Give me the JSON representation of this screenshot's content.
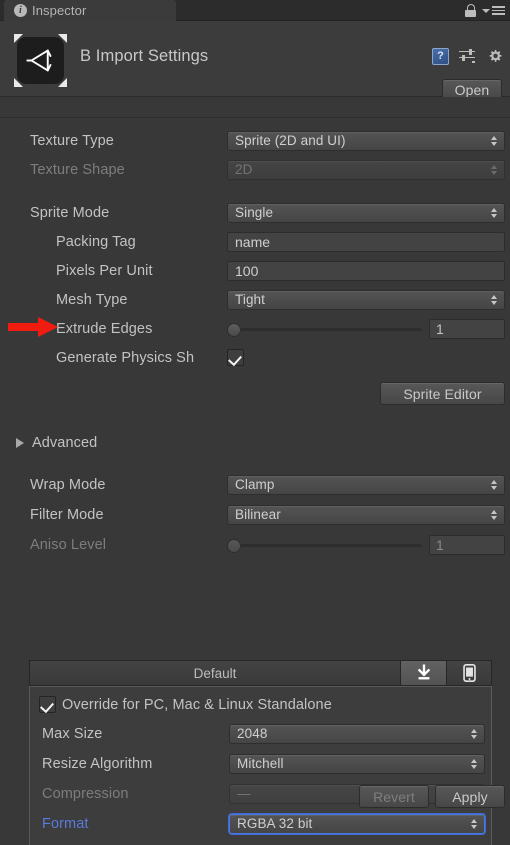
{
  "window": {
    "background_color": "#383838",
    "panel_color": "#3c3c3c"
  },
  "tabbar": {
    "tab_label": "Inspector",
    "info_icon": "info-icon",
    "lock_icon": "lock-icon",
    "menu_icon": "hamburger-menu-icon"
  },
  "header": {
    "object_icon": "unity-asset-icon",
    "title": "B Import Settings",
    "help_icon": "help-book-icon",
    "help_glyph": "?",
    "preset_icon": "preset-sliders-icon",
    "gear_icon": "gear-icon",
    "open_button": "Open"
  },
  "fields": {
    "texture_type": {
      "label": "Texture Type",
      "value": "Sprite (2D and UI)",
      "disabled": false
    },
    "texture_shape": {
      "label": "Texture Shape",
      "value": "2D",
      "disabled": true
    },
    "sprite_mode": {
      "label": "Sprite Mode",
      "value": "Single",
      "disabled": false
    },
    "packing_tag": {
      "label": "Packing Tag",
      "value": "name"
    },
    "pixels_per_unit": {
      "label": "Pixels Per Unit",
      "value": "100"
    },
    "mesh_type": {
      "label": "Mesh Type",
      "value": "Tight",
      "disabled": false
    },
    "extrude_edges": {
      "label": "Extrude Edges",
      "value": "1",
      "slider_percent": 0
    },
    "generate_physics_shape": {
      "label": "Generate Physics Sh",
      "checked": true
    },
    "sprite_editor_button": "Sprite Editor",
    "advanced_foldout": {
      "label": "Advanced",
      "expanded": false
    },
    "wrap_mode": {
      "label": "Wrap Mode",
      "value": "Clamp",
      "disabled": false
    },
    "filter_mode": {
      "label": "Filter Mode",
      "value": "Bilinear",
      "disabled": false
    },
    "aniso_level": {
      "label": "Aniso Level",
      "value": "1",
      "slider_percent": 0,
      "disabled": true
    }
  },
  "platform": {
    "tabs": [
      {
        "label": "Default",
        "icon": "text-tab",
        "selected": false
      },
      {
        "label": "",
        "icon": "standalone-download-icon",
        "selected": true
      },
      {
        "label": "",
        "icon": "mobile-phone-icon",
        "selected": false
      }
    ],
    "override_checkbox": {
      "label": "Override for PC, Mac & Linux Standalone",
      "checked": true
    },
    "max_size": {
      "label": "Max Size",
      "value": "2048",
      "disabled": false
    },
    "resize_algorithm": {
      "label": "Resize Algorithm",
      "value": "Mitchell",
      "disabled": false
    },
    "compression": {
      "label": "Compression",
      "value": "—",
      "disabled": true
    },
    "format": {
      "label": "Format",
      "value": "RGBA 32 bit",
      "disabled": false,
      "highlighted": true,
      "label_color": "#5a7bdc"
    }
  },
  "footer": {
    "revert_button": "Revert",
    "apply_button": "Apply"
  },
  "annotation": {
    "arrow_icon": "red-arrow-annotation",
    "arrow_color": "#f01c10",
    "points_to": "Packing Tag"
  }
}
